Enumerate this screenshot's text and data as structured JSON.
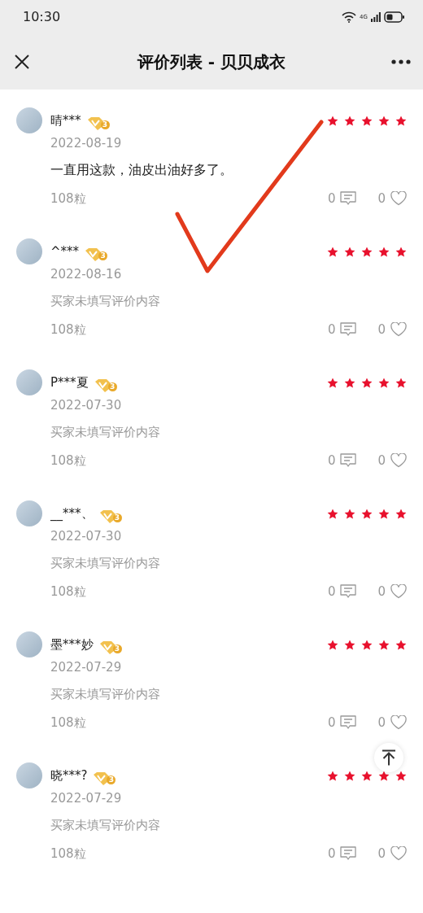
{
  "status_bar": {
    "time": "10:30",
    "network": "4G"
  },
  "header": {
    "title": "评价列表 - 贝贝成衣"
  },
  "reviews": [
    {
      "name": "晴***",
      "level_badge": "3",
      "stars": 5,
      "date": "2022-08-19",
      "kind": "comment",
      "content": "一直用这款，油皮出油好多了。",
      "spec": "108粒",
      "comment_count": "0",
      "like_count": "0"
    },
    {
      "name": "^***",
      "level_badge": "3",
      "stars": 5,
      "date": "2022-08-16",
      "kind": "empty",
      "content": "买家未填写评价内容",
      "spec": "108粒",
      "comment_count": "0",
      "like_count": "0"
    },
    {
      "name": "P***夏",
      "level_badge": "3",
      "stars": 5,
      "date": "2022-07-30",
      "kind": "empty",
      "content": "买家未填写评价内容",
      "spec": "108粒",
      "comment_count": "0",
      "like_count": "0"
    },
    {
      "name": "__***、",
      "level_badge": "3",
      "stars": 5,
      "date": "2022-07-30",
      "kind": "empty",
      "content": "买家未填写评价内容",
      "spec": "108粒",
      "comment_count": "0",
      "like_count": "0"
    },
    {
      "name": "墨***妙",
      "level_badge": "3",
      "stars": 5,
      "date": "2022-07-29",
      "kind": "empty",
      "content": "买家未填写评价内容",
      "spec": "108粒",
      "comment_count": "0",
      "like_count": "0"
    },
    {
      "name": "晓***?",
      "level_badge": "3",
      "stars": 5,
      "date": "2022-07-29",
      "kind": "empty",
      "content": "买家未填写评价内容",
      "spec": "108粒",
      "comment_count": "0",
      "like_count": "0"
    }
  ]
}
